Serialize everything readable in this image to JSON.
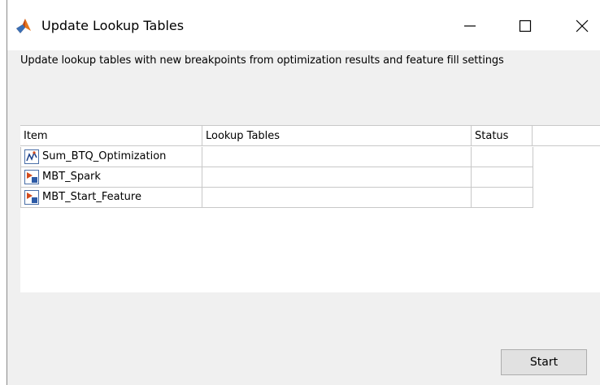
{
  "window": {
    "title": "Update Lookup Tables",
    "controls": {
      "minimize": "—",
      "maximize": "☐",
      "close": "✕"
    },
    "app_icon": "matlab-membrane-icon"
  },
  "description": "Update lookup tables with new breakpoints from optimization results and feature fill settings",
  "table": {
    "columns": [
      "Item",
      "Lookup Tables",
      "Status",
      ""
    ],
    "rows": [
      {
        "icon": "optimization-icon",
        "item": "Sum_BTQ_Optimization",
        "lookup": "",
        "status": ""
      },
      {
        "icon": "model-icon",
        "item": "MBT_Spark",
        "lookup": "",
        "status": ""
      },
      {
        "icon": "model-icon",
        "item": "MBT_Start_Feature",
        "lookup": "",
        "status": ""
      }
    ]
  },
  "buttons": {
    "start": "Start"
  },
  "colors": {
    "window_bg": "#f0f0f0",
    "button_bg": "#e1e1e1",
    "grid": "#c8c8c8"
  }
}
